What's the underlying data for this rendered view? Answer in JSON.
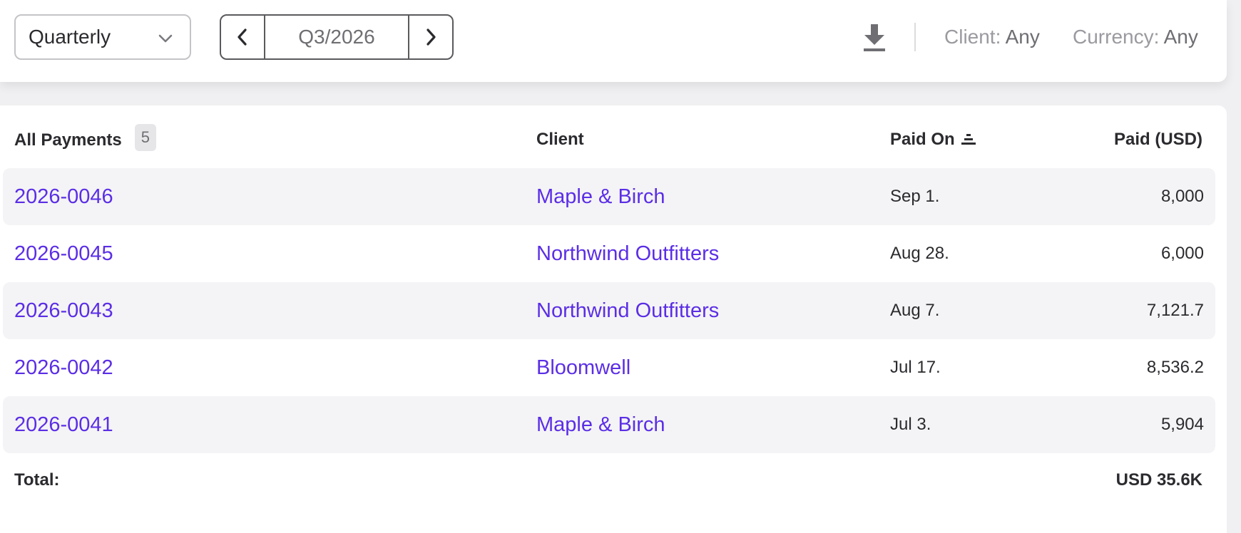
{
  "toolbar": {
    "period_type": "Quarterly",
    "period": "Q3/2026",
    "filters": {
      "client_label": "Client:",
      "client_value": "Any",
      "currency_label": "Currency:",
      "currency_value": "Any"
    },
    "icons": {
      "dropdown": "chevron-down-icon",
      "prev": "chevron-left-icon",
      "next": "chevron-right-icon",
      "download": "download-icon",
      "sort": "sort-descending-icon"
    }
  },
  "table": {
    "title": "All Payments",
    "count": "5",
    "columns": {
      "client": "Client",
      "paid_on": "Paid On",
      "amount": "Paid (USD)"
    },
    "rows": [
      {
        "id": "2026-0046",
        "client": "Maple & Birch",
        "paid_on": "Sep 1.",
        "amount": "8,000"
      },
      {
        "id": "2026-0045",
        "client": "Northwind Outfitters",
        "paid_on": "Aug 28.",
        "amount": "6,000"
      },
      {
        "id": "2026-0043",
        "client": "Northwind Outfitters",
        "paid_on": "Aug 7.",
        "amount": "7,121.7"
      },
      {
        "id": "2026-0042",
        "client": "Bloomwell",
        "paid_on": "Jul 17.",
        "amount": "8,536.2"
      },
      {
        "id": "2026-0041",
        "client": "Maple & Birch",
        "paid_on": "Jul 3.",
        "amount": "5,904"
      }
    ],
    "total_label": "Total:",
    "total_value": "USD 35.6K"
  },
  "colors": {
    "link": "#5b2ee6",
    "row_alt": "#f4f4f6",
    "text": "#2b2b2f",
    "muted": "#9a9aa0"
  }
}
